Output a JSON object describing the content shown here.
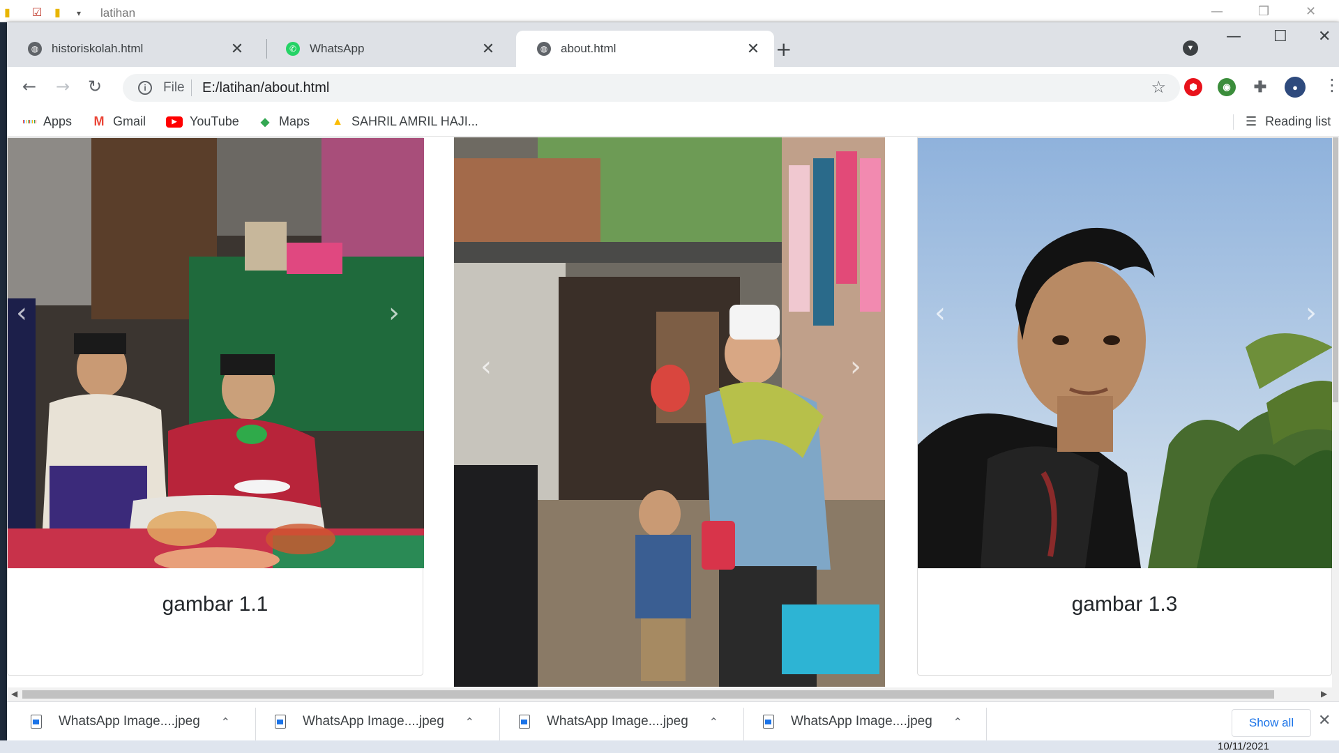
{
  "explorer": {
    "title": "latihan"
  },
  "tabs": [
    {
      "title": "historiskolah.html",
      "icon": "globe-icon",
      "active": false
    },
    {
      "title": "WhatsApp",
      "icon": "whatsapp-icon",
      "active": false
    },
    {
      "title": "about.html",
      "icon": "globe-icon",
      "active": true
    }
  ],
  "omnibox": {
    "scheme": "File",
    "url": "E:/latihan/about.html"
  },
  "bookmarks": [
    {
      "label": "Apps",
      "icon": "apps-grid-icon"
    },
    {
      "label": "Gmail",
      "icon": "gmail-icon"
    },
    {
      "label": "YouTube",
      "icon": "youtube-icon"
    },
    {
      "label": "Maps",
      "icon": "maps-icon"
    },
    {
      "label": "SAHRIL AMRIL HAJI...",
      "icon": "drive-icon"
    }
  ],
  "reading_list": "Reading list",
  "cards": [
    {
      "caption": "gambar 1.1",
      "photo": "people eating on floor mat"
    },
    {
      "caption": "",
      "photo": "man in white cap handing snack to boy"
    },
    {
      "caption": "gambar 1.3",
      "photo": "young man with palm trees and sky"
    }
  ],
  "downloads": [
    {
      "name": "WhatsApp Image....jpeg"
    },
    {
      "name": "WhatsApp Image....jpeg"
    },
    {
      "name": "WhatsApp Image....jpeg"
    },
    {
      "name": "WhatsApp Image....jpeg"
    }
  ],
  "show_all": "Show all",
  "taskbar": {
    "date": "10/11/2021"
  },
  "colors": {
    "accent": "#1a73e8",
    "tabstrip": "#dee1e6",
    "whatsapp": "#25d366"
  }
}
